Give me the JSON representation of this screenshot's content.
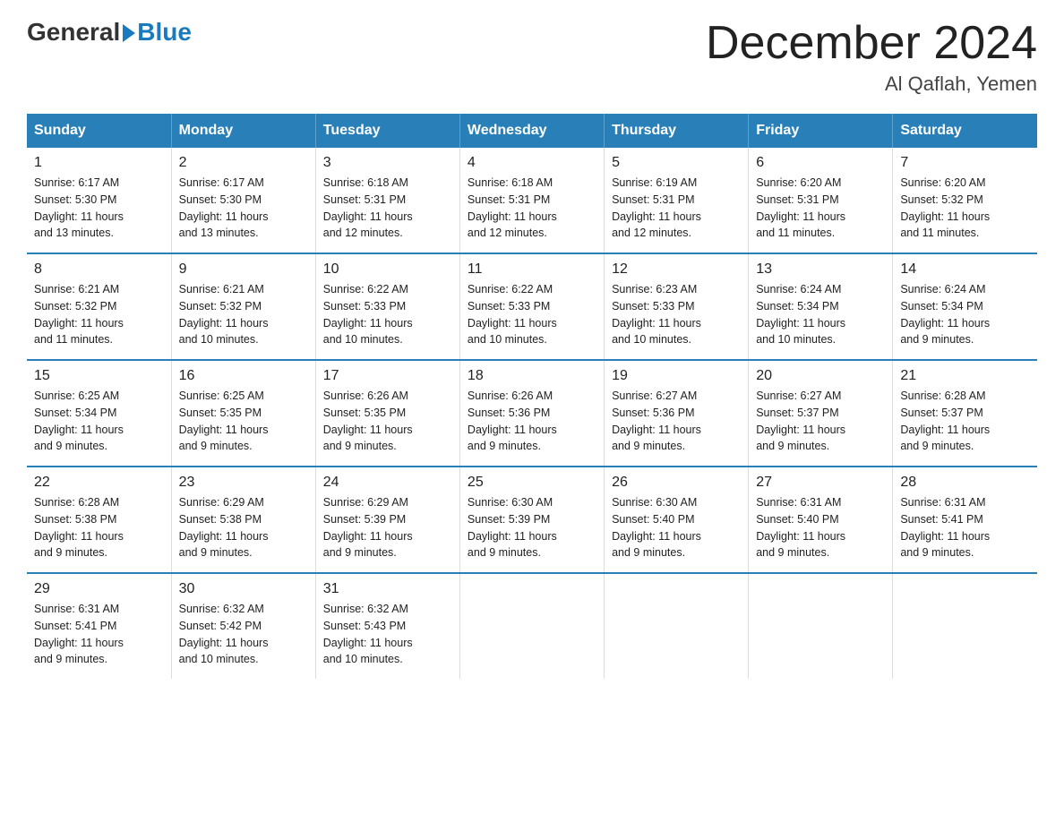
{
  "logo": {
    "general": "General",
    "blue": "Blue"
  },
  "title": "December 2024",
  "location": "Al Qaflah, Yemen",
  "days_of_week": [
    "Sunday",
    "Monday",
    "Tuesday",
    "Wednesday",
    "Thursday",
    "Friday",
    "Saturday"
  ],
  "weeks": [
    [
      {
        "day": "1",
        "info": "Sunrise: 6:17 AM\nSunset: 5:30 PM\nDaylight: 11 hours\nand 13 minutes."
      },
      {
        "day": "2",
        "info": "Sunrise: 6:17 AM\nSunset: 5:30 PM\nDaylight: 11 hours\nand 13 minutes."
      },
      {
        "day": "3",
        "info": "Sunrise: 6:18 AM\nSunset: 5:31 PM\nDaylight: 11 hours\nand 12 minutes."
      },
      {
        "day": "4",
        "info": "Sunrise: 6:18 AM\nSunset: 5:31 PM\nDaylight: 11 hours\nand 12 minutes."
      },
      {
        "day": "5",
        "info": "Sunrise: 6:19 AM\nSunset: 5:31 PM\nDaylight: 11 hours\nand 12 minutes."
      },
      {
        "day": "6",
        "info": "Sunrise: 6:20 AM\nSunset: 5:31 PM\nDaylight: 11 hours\nand 11 minutes."
      },
      {
        "day": "7",
        "info": "Sunrise: 6:20 AM\nSunset: 5:32 PM\nDaylight: 11 hours\nand 11 minutes."
      }
    ],
    [
      {
        "day": "8",
        "info": "Sunrise: 6:21 AM\nSunset: 5:32 PM\nDaylight: 11 hours\nand 11 minutes."
      },
      {
        "day": "9",
        "info": "Sunrise: 6:21 AM\nSunset: 5:32 PM\nDaylight: 11 hours\nand 10 minutes."
      },
      {
        "day": "10",
        "info": "Sunrise: 6:22 AM\nSunset: 5:33 PM\nDaylight: 11 hours\nand 10 minutes."
      },
      {
        "day": "11",
        "info": "Sunrise: 6:22 AM\nSunset: 5:33 PM\nDaylight: 11 hours\nand 10 minutes."
      },
      {
        "day": "12",
        "info": "Sunrise: 6:23 AM\nSunset: 5:33 PM\nDaylight: 11 hours\nand 10 minutes."
      },
      {
        "day": "13",
        "info": "Sunrise: 6:24 AM\nSunset: 5:34 PM\nDaylight: 11 hours\nand 10 minutes."
      },
      {
        "day": "14",
        "info": "Sunrise: 6:24 AM\nSunset: 5:34 PM\nDaylight: 11 hours\nand 9 minutes."
      }
    ],
    [
      {
        "day": "15",
        "info": "Sunrise: 6:25 AM\nSunset: 5:34 PM\nDaylight: 11 hours\nand 9 minutes."
      },
      {
        "day": "16",
        "info": "Sunrise: 6:25 AM\nSunset: 5:35 PM\nDaylight: 11 hours\nand 9 minutes."
      },
      {
        "day": "17",
        "info": "Sunrise: 6:26 AM\nSunset: 5:35 PM\nDaylight: 11 hours\nand 9 minutes."
      },
      {
        "day": "18",
        "info": "Sunrise: 6:26 AM\nSunset: 5:36 PM\nDaylight: 11 hours\nand 9 minutes."
      },
      {
        "day": "19",
        "info": "Sunrise: 6:27 AM\nSunset: 5:36 PM\nDaylight: 11 hours\nand 9 minutes."
      },
      {
        "day": "20",
        "info": "Sunrise: 6:27 AM\nSunset: 5:37 PM\nDaylight: 11 hours\nand 9 minutes."
      },
      {
        "day": "21",
        "info": "Sunrise: 6:28 AM\nSunset: 5:37 PM\nDaylight: 11 hours\nand 9 minutes."
      }
    ],
    [
      {
        "day": "22",
        "info": "Sunrise: 6:28 AM\nSunset: 5:38 PM\nDaylight: 11 hours\nand 9 minutes."
      },
      {
        "day": "23",
        "info": "Sunrise: 6:29 AM\nSunset: 5:38 PM\nDaylight: 11 hours\nand 9 minutes."
      },
      {
        "day": "24",
        "info": "Sunrise: 6:29 AM\nSunset: 5:39 PM\nDaylight: 11 hours\nand 9 minutes."
      },
      {
        "day": "25",
        "info": "Sunrise: 6:30 AM\nSunset: 5:39 PM\nDaylight: 11 hours\nand 9 minutes."
      },
      {
        "day": "26",
        "info": "Sunrise: 6:30 AM\nSunset: 5:40 PM\nDaylight: 11 hours\nand 9 minutes."
      },
      {
        "day": "27",
        "info": "Sunrise: 6:31 AM\nSunset: 5:40 PM\nDaylight: 11 hours\nand 9 minutes."
      },
      {
        "day": "28",
        "info": "Sunrise: 6:31 AM\nSunset: 5:41 PM\nDaylight: 11 hours\nand 9 minutes."
      }
    ],
    [
      {
        "day": "29",
        "info": "Sunrise: 6:31 AM\nSunset: 5:41 PM\nDaylight: 11 hours\nand 9 minutes."
      },
      {
        "day": "30",
        "info": "Sunrise: 6:32 AM\nSunset: 5:42 PM\nDaylight: 11 hours\nand 10 minutes."
      },
      {
        "day": "31",
        "info": "Sunrise: 6:32 AM\nSunset: 5:43 PM\nDaylight: 11 hours\nand 10 minutes."
      },
      {
        "day": "",
        "info": ""
      },
      {
        "day": "",
        "info": ""
      },
      {
        "day": "",
        "info": ""
      },
      {
        "day": "",
        "info": ""
      }
    ]
  ]
}
